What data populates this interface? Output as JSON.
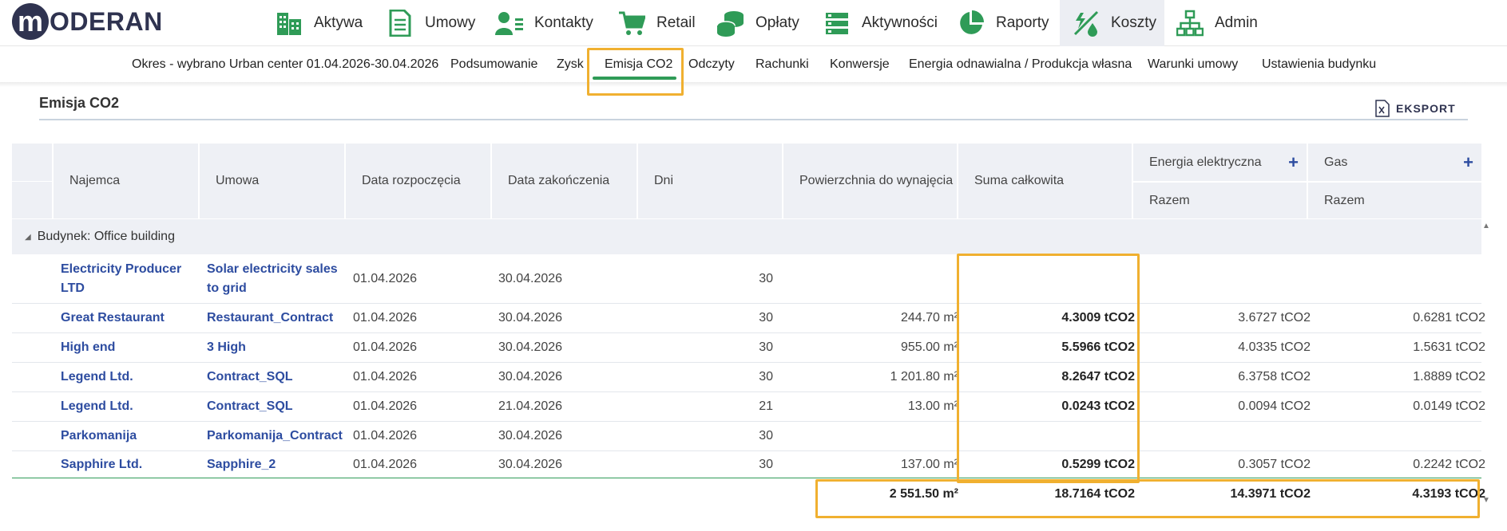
{
  "brand": {
    "logo_letter": "m",
    "logo_text": "ODERAN"
  },
  "nav": {
    "items": [
      {
        "label": "Aktywa",
        "icon": "buildings-icon"
      },
      {
        "label": "Umowy",
        "icon": "document-icon"
      },
      {
        "label": "Kontakty",
        "icon": "contacts-icon"
      },
      {
        "label": "Retail",
        "icon": "cart-icon"
      },
      {
        "label": "Opłaty",
        "icon": "coins-icon"
      },
      {
        "label": "Aktywności",
        "icon": "list-icon"
      },
      {
        "label": "Raporty",
        "icon": "pie-chart-icon"
      },
      {
        "label": "Koszty",
        "icon": "costs-icon",
        "active": true
      },
      {
        "label": "Admin",
        "icon": "org-chart-icon"
      }
    ],
    "icon_color": "#2f9b57"
  },
  "subnav": {
    "period": "Okres - wybrano Urban center 01.04.2026-30.04.2026",
    "tabs": [
      "Podsumowanie",
      "Zysk",
      "Emisja CO2",
      "Odczyty",
      "Rachunki",
      "Konwersje",
      "Energia odnawialna / Produkcja własna",
      "Warunki umowy",
      "Ustawienia budynku"
    ],
    "active_tab": "Emisja CO2",
    "active_color": "#2f9b57"
  },
  "section": {
    "title": "Emisja CO2",
    "export_label": "EKSPORT"
  },
  "table": {
    "headers": {
      "tenant": "Najemca",
      "contract": "Umowa",
      "start": "Data rozpoczęcia",
      "end": "Data zakończenia",
      "days": "Dni",
      "area": "Powierzchnia do wynajęcia",
      "total": "Suma całkowita",
      "electricity": "Energia elektryczna",
      "gas": "Gas",
      "sub_total": "Razem"
    },
    "group_label": "Budynek: Office building",
    "rows": [
      {
        "tenant": "Electricity Producer LTD",
        "contract": "Solar electricity sales to grid",
        "start": "01.04.2026",
        "end": "30.04.2026",
        "days": "30",
        "area": "",
        "total": "",
        "electricity": "",
        "gas": ""
      },
      {
        "tenant": "Great Restaurant",
        "contract": "Restaurant_Contract",
        "start": "01.04.2026",
        "end": "30.04.2026",
        "days": "30",
        "area": "244.70 m²",
        "total": "4.3009 tCO2",
        "electricity": "3.6727 tCO2",
        "gas": "0.6281 tCO2"
      },
      {
        "tenant": "High end",
        "contract": "3 High",
        "start": "01.04.2026",
        "end": "30.04.2026",
        "days": "30",
        "area": "955.00 m²",
        "total": "5.5966 tCO2",
        "electricity": "4.0335 tCO2",
        "gas": "1.5631 tCO2"
      },
      {
        "tenant": "Legend Ltd.",
        "contract": "Contract_SQL",
        "start": "01.04.2026",
        "end": "30.04.2026",
        "days": "30",
        "area": "1 201.80 m²",
        "total": "8.2647 tCO2",
        "electricity": "6.3758 tCO2",
        "gas": "1.8889 tCO2"
      },
      {
        "tenant": "Legend Ltd.",
        "contract": "Contract_SQL",
        "start": "01.04.2026",
        "end": "21.04.2026",
        "days": "21",
        "area": "13.00 m²",
        "total": "0.0243 tCO2",
        "electricity": "0.0094 tCO2",
        "gas": "0.0149 tCO2"
      },
      {
        "tenant": "Parkomanija",
        "contract": "Parkomanija_Contract",
        "start": "01.04.2026",
        "end": "30.04.2026",
        "days": "30",
        "area": "",
        "total": "",
        "electricity": "",
        "gas": ""
      },
      {
        "tenant": "Sapphire Ltd.",
        "contract": "Sapphire_2",
        "start": "01.04.2026",
        "end": "30.04.2026",
        "days": "30",
        "area": "137.00 m²",
        "total": "0.5299 tCO2",
        "electricity": "0.3057 tCO2",
        "gas": "0.2242 tCO2"
      }
    ],
    "totals": {
      "area": "2 551.50 m²",
      "total": "18.7164 tCO2",
      "electricity": "14.3971 tCO2",
      "gas": "4.3193 tCO2"
    }
  },
  "colors": {
    "link": "#2d4ca0",
    "highlight": "#f0b030",
    "header_bg": "#eef0f5",
    "brand_dark": "#2f3350"
  }
}
